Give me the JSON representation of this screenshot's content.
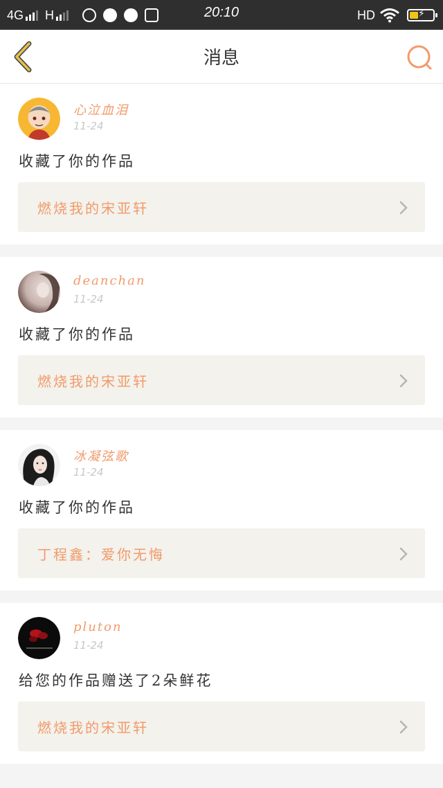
{
  "status_bar": {
    "network_4g": "4G",
    "network_h": "H",
    "time": "20:10",
    "hd": "HD"
  },
  "header": {
    "title": "消息"
  },
  "messages": [
    {
      "username": "心泣血泪",
      "date": "11-24",
      "action": "收藏了你的作品",
      "work_title": "燃烧我的宋亚轩"
    },
    {
      "username": "deanchan",
      "date": "11-24",
      "action": "收藏了你的作品",
      "work_title": "燃烧我的宋亚轩"
    },
    {
      "username": "冰凝弦歌",
      "date": "11-24",
      "action": "收藏了你的作品",
      "work_title": "丁程鑫：爱你无悔"
    },
    {
      "username": "pluton",
      "date": "11-24",
      "action": "给您的作品赠送了2朵鲜花",
      "work_title": "燃烧我的宋亚轩"
    }
  ],
  "colors": {
    "accent": "#f19a6a",
    "back_icon": "#e6c24a",
    "status_bar_bg": "#2f2f2f",
    "card_link_bg": "#f3f2ec"
  }
}
